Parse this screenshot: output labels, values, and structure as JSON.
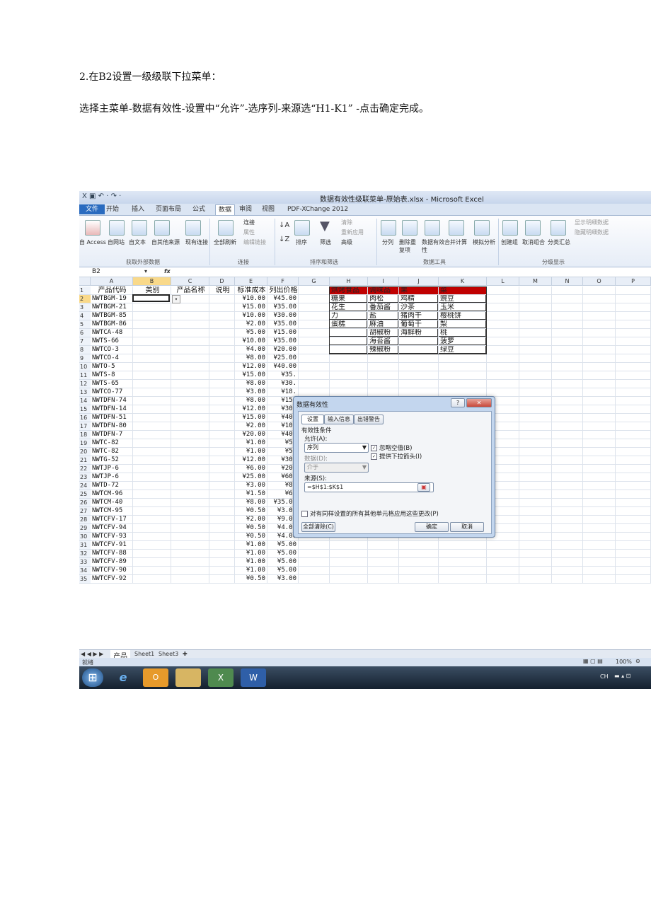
{
  "doc": {
    "heading": "2.在B2设置一级级联下拉菜单：",
    "instruction": "选择主菜单-数据有效性-设置中“允许”-选序列-来源选“H1-K1” -点击确定完成。"
  },
  "excel": {
    "title": "数据有效性级联菜单-原始表.xlsx - Microsoft Excel",
    "tabs": [
      "文件",
      "开始",
      "插入",
      "页面布局",
      "公式",
      "数据",
      "审阅",
      "视图",
      "PDF-XChange 2012"
    ],
    "active_tab": "数据",
    "ribbon": {
      "external_buttons": [
        "自 Access",
        "自网站",
        "自文本",
        "自其他来源",
        "现有连接"
      ],
      "refresh_all": "全部刷新",
      "conn_items": [
        "连接",
        "属性",
        "编辑链接"
      ],
      "sort_items": [
        "排序",
        "筛选"
      ],
      "filter_items": [
        "清除",
        "重新应用",
        "高级"
      ],
      "tools_buttons": [
        "分列",
        "删除重复项",
        "数据有效性",
        "合并计算",
        "模拟分析"
      ],
      "outline_buttons": [
        "创建组",
        "取消组合",
        "分类汇总"
      ],
      "outline_items": [
        "显示明细数据",
        "隐藏明细数据"
      ],
      "groups": [
        "获取外部数据",
        "连接",
        "排序和筛选",
        "数据工具",
        "分级显示"
      ]
    },
    "name_box": "B2",
    "fx": "fx",
    "columns": [
      "A",
      "B",
      "C",
      "D",
      "E",
      "F",
      "G",
      "H",
      "I",
      "J",
      "K",
      "L",
      "M",
      "N",
      "O",
      "P"
    ],
    "headers": [
      "产品代码",
      "类别",
      "产品名称",
      "说明",
      "标准成本",
      "列出价格"
    ],
    "rows": [
      [
        "NWTBGM-19",
        "¥10.00",
        "¥45.00"
      ],
      [
        "NWTBGM-21",
        "¥15.00",
        "¥35.00"
      ],
      [
        "NWTBGM-85",
        "¥10.00",
        "¥30.00"
      ],
      [
        "NWTBGM-86",
        "¥2.00",
        "¥35.00"
      ],
      [
        "NWTCA-48",
        "¥5.00",
        "¥15.00"
      ],
      [
        "NWTS-66",
        "¥10.00",
        "¥35.00"
      ],
      [
        "NWTCO-3",
        "¥4.00",
        "¥20.00"
      ],
      [
        "NWTCO-4",
        "¥8.00",
        "¥25.00"
      ],
      [
        "NWTO-5",
        "¥12.00",
        "¥40.00"
      ],
      [
        "NWTS-8",
        "¥15.00",
        "¥35."
      ],
      [
        "NWTS-65",
        "¥8.00",
        "¥30."
      ],
      [
        "NWTCO-77",
        "¥3.00",
        "¥18."
      ],
      [
        "NWTDFN-74",
        "¥8.00",
        "¥15."
      ],
      [
        "NWTDFN-14",
        "¥12.00",
        "¥30."
      ],
      [
        "NWTDFN-51",
        "¥15.00",
        "¥40."
      ],
      [
        "NWTDFN-80",
        "¥2.00",
        "¥10."
      ],
      [
        "NWTDFN-7",
        "¥20.00",
        "¥40."
      ],
      [
        "NWTC-82",
        "¥1.00",
        "¥5."
      ],
      [
        "NWTC-82",
        "¥1.00",
        "¥5."
      ],
      [
        "NWTG-52",
        "¥12.00",
        "¥30."
      ],
      [
        "NWTJP-6",
        "¥6.00",
        "¥20."
      ],
      [
        "NWTJP-6",
        "¥25.00",
        "¥60."
      ],
      [
        "NWTD-72",
        "¥3.00",
        "¥8."
      ],
      [
        "NWTCM-96",
        "¥1.50",
        "¥6."
      ],
      [
        "NWTCM-40",
        "¥8.00",
        "¥35.00"
      ],
      [
        "NWTCM-95",
        "¥0.50",
        "¥3.00"
      ],
      [
        "NWTCFV-17",
        "¥2.00",
        "¥9.00"
      ],
      [
        "NWTCFV-94",
        "¥0.50",
        "¥4.00"
      ],
      [
        "NWTCFV-93",
        "¥0.50",
        "¥4.00"
      ],
      [
        "NWTCFV-91",
        "¥1.00",
        "¥5.00"
      ],
      [
        "NWTCFV-88",
        "¥1.00",
        "¥5.00"
      ],
      [
        "NWTCFV-89",
        "¥1.00",
        "¥5.00"
      ],
      [
        "NWTCFV-90",
        "¥1.00",
        "¥5.00"
      ],
      [
        "NWTCFV-92",
        "¥0.50",
        "¥3.00"
      ]
    ],
    "lookup_headers": [
      "烘烤食品",
      "调味品",
      "果",
      "菜"
    ],
    "lookup_rows": [
      [
        "糖果",
        "肉松",
        "鸡精",
        "豌豆"
      ],
      [
        "花生",
        "番茄酱",
        "沙茶",
        "玉米"
      ],
      [
        "力",
        "盐",
        "猪肉干",
        "樱桃饼"
      ],
      [
        "蛋糕",
        "麻油",
        "葡萄干",
        "梨"
      ],
      [
        "",
        "胡椒粉",
        "海鲜粉",
        "桃"
      ],
      [
        "",
        "海苔酱",
        "",
        "菠萝"
      ],
      [
        "",
        "辣椒粉",
        "",
        "绿豆"
      ]
    ],
    "dialog": {
      "title": "数据有效性",
      "tabs": [
        "设置",
        "输入信息",
        "出错警告"
      ],
      "section": "有效性条件",
      "allow_label": "允许(A):",
      "allow_value": "序列",
      "ignore_blank": "忽略空值(B)",
      "dropdown": "提供下拉箭头(I)",
      "data_label": "数据(D):",
      "data_value": "介于",
      "source_label": "来源(S):",
      "source_value": "=$H$1:$K$1",
      "apply_all": "对有同样设置的所有其他单元格应用这些更改(P)",
      "clear_all": "全部清除(C)",
      "ok": "确定",
      "cancel": "取消"
    },
    "sheets": [
      "产品",
      "Sheet1",
      "Sheet3"
    ],
    "status": "就绪",
    "zoom": "100%",
    "tray": "CH"
  }
}
